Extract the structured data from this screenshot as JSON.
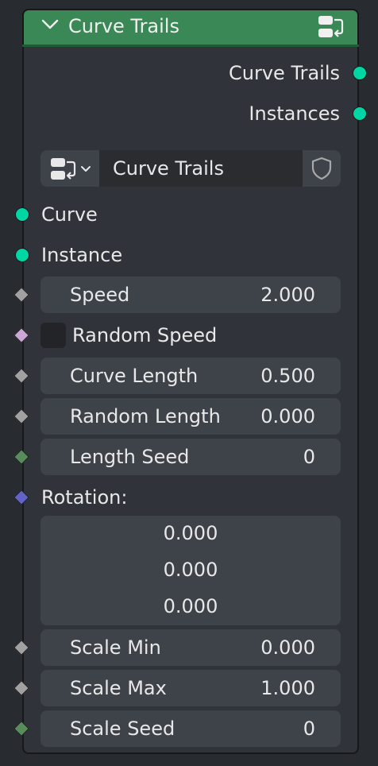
{
  "node": {
    "title": "Curve Trails",
    "outputs": [
      "Curve Trails",
      "Instances"
    ],
    "group_selector": {
      "name": "Curve Trails"
    },
    "inputs": {
      "curve": "Curve",
      "instance": "Instance",
      "speed": {
        "label": "Speed",
        "value": "2.000"
      },
      "random_speed": {
        "label": "Random Speed",
        "checked": false
      },
      "curve_length": {
        "label": "Curve Length",
        "value": "0.500"
      },
      "random_length": {
        "label": "Random Length",
        "value": "0.000"
      },
      "length_seed": {
        "label": "Length Seed",
        "value": "0"
      },
      "rotation": {
        "label": "Rotation:",
        "values": [
          "0.000",
          "0.000",
          "0.000"
        ]
      },
      "scale_min": {
        "label": "Scale Min",
        "value": "0.000"
      },
      "scale_max": {
        "label": "Scale Max",
        "value": "1.000"
      },
      "scale_seed": {
        "label": "Scale Seed",
        "value": "0"
      }
    }
  },
  "colors": {
    "header": "#3a8855",
    "geometry_socket": "#00d6a3",
    "float_socket": "#a1a1a1",
    "bool_socket": "#cca6d6",
    "int_socket": "#598c5c",
    "vector_socket": "#6363c7"
  }
}
